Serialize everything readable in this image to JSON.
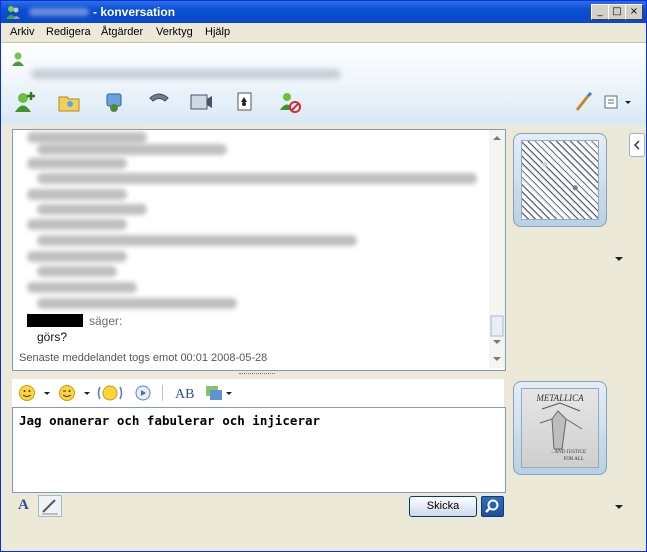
{
  "window": {
    "title": "- konversation",
    "controls": [
      "minimize",
      "maximize",
      "close"
    ]
  },
  "menu": [
    {
      "label": "Arkiv"
    },
    {
      "label": "Redigera"
    },
    {
      "label": "Åtgärder"
    },
    {
      "label": "Verktyg"
    },
    {
      "label": "Hjälp"
    }
  ],
  "header": {
    "contact_icon": "buddy-icon"
  },
  "toolbar": {
    "icons": [
      "invite-contact-icon",
      "share-folder-icon",
      "voice-call-icon",
      "phone-icon",
      "video-icon",
      "games-icon",
      "block-icon",
      "paintbrush-icon",
      "display-options-icon"
    ]
  },
  "conversation": {
    "visible_line_1": "säger:",
    "visible_line_2": "görs?",
    "status": "Senaste meddelandet togs emot 00:01 2008-05-28"
  },
  "compose": {
    "text": "Jag onanerar och fabulerar och injicerar",
    "toolbar_icons": [
      "emoticon-icon",
      "wink-icon",
      "nudge-icon",
      "voice-clip-icon",
      "font-icon",
      "background-icon"
    ]
  },
  "bottom": {
    "font_button": "A",
    "send_label": "Skicka"
  },
  "pictures": {
    "contact_picture": "contact-display-picture",
    "my_picture": "album-cover-picture",
    "album_text": [
      "METALLICA",
      "...AND JUSTICE",
      "FOR ALL"
    ]
  }
}
